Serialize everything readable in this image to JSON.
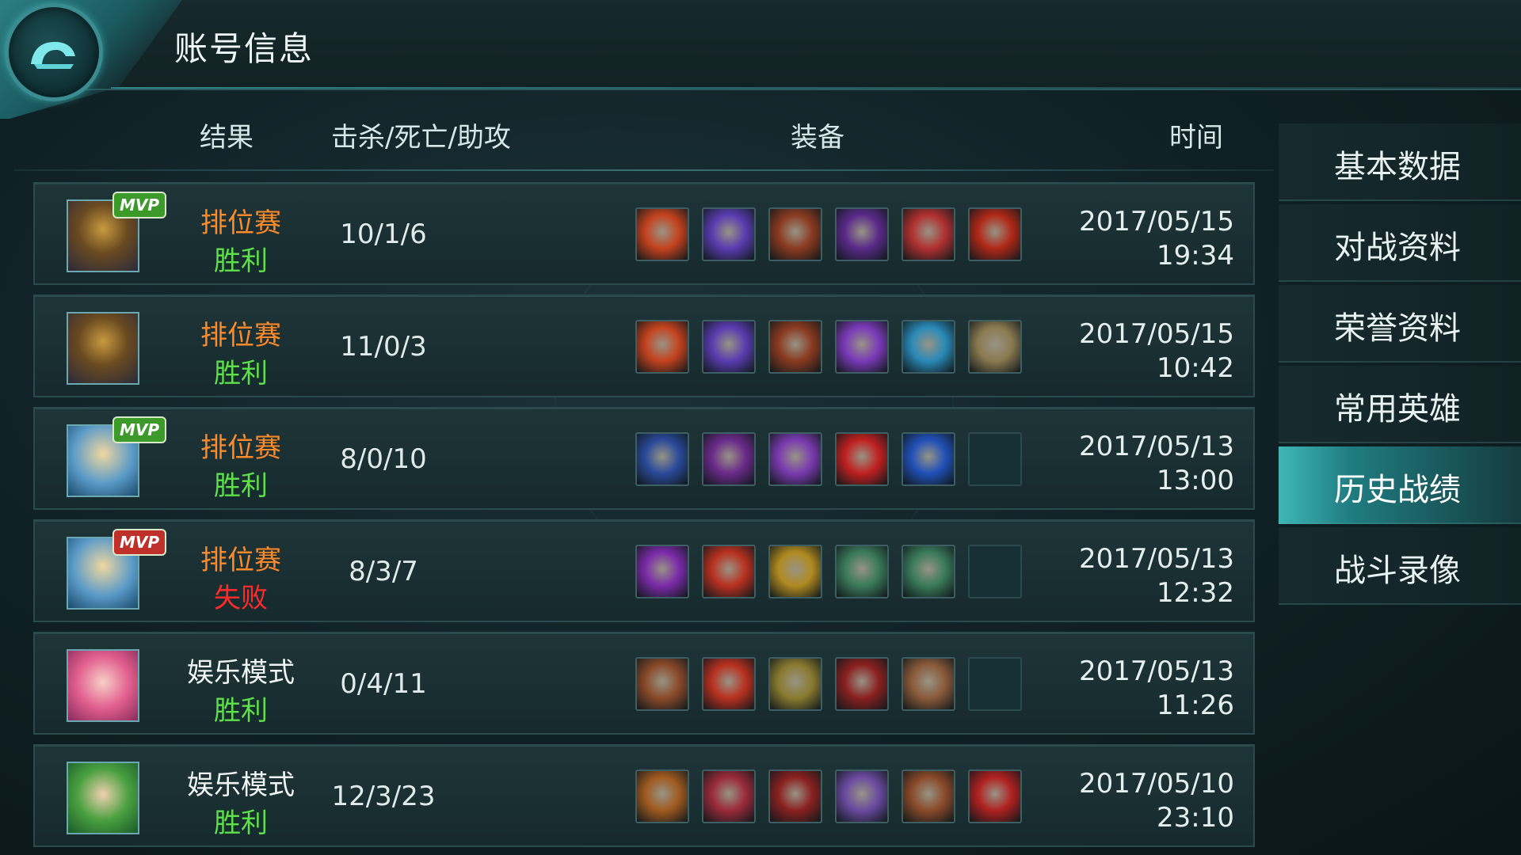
{
  "header": {
    "title": "账号信息"
  },
  "columns": {
    "result": "结果",
    "kda": "击杀/死亡/助攻",
    "equipment": "装备",
    "time": "时间"
  },
  "sidebar": {
    "items": [
      {
        "label": "基本数据",
        "active": false
      },
      {
        "label": "对战资料",
        "active": false
      },
      {
        "label": "荣誉资料",
        "active": false
      },
      {
        "label": "常用英雄",
        "active": false
      },
      {
        "label": "历史战绩",
        "active": true
      },
      {
        "label": "战斗录像",
        "active": false
      }
    ]
  },
  "matches": [
    {
      "hero": "hero-armored-warrior-portrait",
      "mvp": "MVP",
      "mvp_color": "#3c9a2a",
      "mode": "排位赛",
      "mode_color": "#ff8a2a",
      "result": "胜利",
      "result_color": "#5ee04a",
      "kda": "10/1/6",
      "date": "2017/05/15",
      "time": "19:34",
      "items": [
        {
          "name": "flame-armor-icon",
          "color": "#c4421e"
        },
        {
          "name": "purple-boots-icon",
          "color": "#5a3cb0"
        },
        {
          "name": "spiked-shield-icon",
          "color": "#8a3a20"
        },
        {
          "name": "dark-spear-icon",
          "color": "#5a2a8a"
        },
        {
          "name": "red-crest-shield-icon",
          "color": "#b03030"
        },
        {
          "name": "red-orb-icon",
          "color": "#b02818"
        }
      ]
    },
    {
      "hero": "hero-armored-warrior-portrait",
      "mvp": "",
      "mvp_color": "",
      "mode": "排位赛",
      "mode_color": "#ff8a2a",
      "result": "胜利",
      "result_color": "#5ee04a",
      "kda": "11/0/3",
      "date": "2017/05/15",
      "time": "10:42",
      "items": [
        {
          "name": "flame-armor-icon",
          "color": "#c4421e"
        },
        {
          "name": "purple-boots-icon",
          "color": "#5a3cb0"
        },
        {
          "name": "spiked-shield-icon",
          "color": "#8a3a20"
        },
        {
          "name": "crystal-cluster-icon",
          "color": "#7a3ab8"
        },
        {
          "name": "blue-gem-icon",
          "color": "#2a8ab8"
        },
        {
          "name": "round-shield-icon",
          "color": "#8a7a50"
        }
      ]
    },
    {
      "hero": "hero-blonde-mage-portrait",
      "mvp": "MVP",
      "mvp_color": "#3c9a2a",
      "mode": "排位赛",
      "mode_color": "#ff8a2a",
      "result": "胜利",
      "result_color": "#5ee04a",
      "kda": "8/0/10",
      "date": "2017/05/13",
      "time": "13:00",
      "items": [
        {
          "name": "blue-scepter-icon",
          "color": "#2a4a9a"
        },
        {
          "name": "crescent-staff-icon",
          "color": "#6a2a8a"
        },
        {
          "name": "purple-wand-icon",
          "color": "#7a3ab0"
        },
        {
          "name": "red-ruby-icon",
          "color": "#c02020"
        },
        {
          "name": "blue-flame-gem-icon",
          "color": "#2050b8"
        },
        {
          "name": "empty-slot",
          "color": ""
        }
      ]
    },
    {
      "hero": "hero-blonde-mage-portrait",
      "mvp": "MVP",
      "mvp_color": "#c0302a",
      "mode": "排位赛",
      "mode_color": "#ff8a2a",
      "result": "失败",
      "result_color": "#ff2a2a",
      "kda": "8/3/7",
      "date": "2017/05/13",
      "time": "12:32",
      "items": [
        {
          "name": "magic-tome-icon",
          "color": "#7a2aa8"
        },
        {
          "name": "red-boots-icon",
          "color": "#b83020"
        },
        {
          "name": "golden-chalice-icon",
          "color": "#b08a20"
        },
        {
          "name": "green-book-icon",
          "color": "#3a7a5a"
        },
        {
          "name": "green-book-icon",
          "color": "#3a7a5a"
        },
        {
          "name": "empty-slot",
          "color": ""
        }
      ]
    },
    {
      "hero": "hero-pink-hair-portrait",
      "mvp": "",
      "mvp_color": "",
      "mode": "娱乐模式",
      "mode_color": "#f0f4f4",
      "result": "胜利",
      "result_color": "#5ee04a",
      "kda": "0/4/11",
      "date": "2017/05/13",
      "time": "11:26",
      "items": [
        {
          "name": "ornate-sword-icon",
          "color": "#8a4a2a"
        },
        {
          "name": "red-boots-icon",
          "color": "#b83020"
        },
        {
          "name": "trident-icon",
          "color": "#8a7a30"
        },
        {
          "name": "dark-gauntlet-icon",
          "color": "#8a2020"
        },
        {
          "name": "crossed-blades-icon",
          "color": "#8a5a3a"
        },
        {
          "name": "empty-slot",
          "color": ""
        }
      ]
    },
    {
      "hero": "hero-green-hair-portrait",
      "mvp": "",
      "mvp_color": "",
      "mode": "娱乐模式",
      "mode_color": "#f0f4f4",
      "result": "胜利",
      "result_color": "#5ee04a",
      "kda": "12/3/23",
      "date": "2017/05/10",
      "time": "23:10",
      "items": [
        {
          "name": "golden-crown-icon",
          "color": "#a05a20"
        },
        {
          "name": "crimson-boots-icon",
          "color": "#9a2a3a"
        },
        {
          "name": "dark-gauntlet-icon",
          "color": "#8a2020"
        },
        {
          "name": "war-hammer-icon",
          "color": "#6a4aa0"
        },
        {
          "name": "ornate-sword-icon",
          "color": "#8a4a2a"
        },
        {
          "name": "ruby-amulet-icon",
          "color": "#b02020"
        }
      ]
    }
  ]
}
